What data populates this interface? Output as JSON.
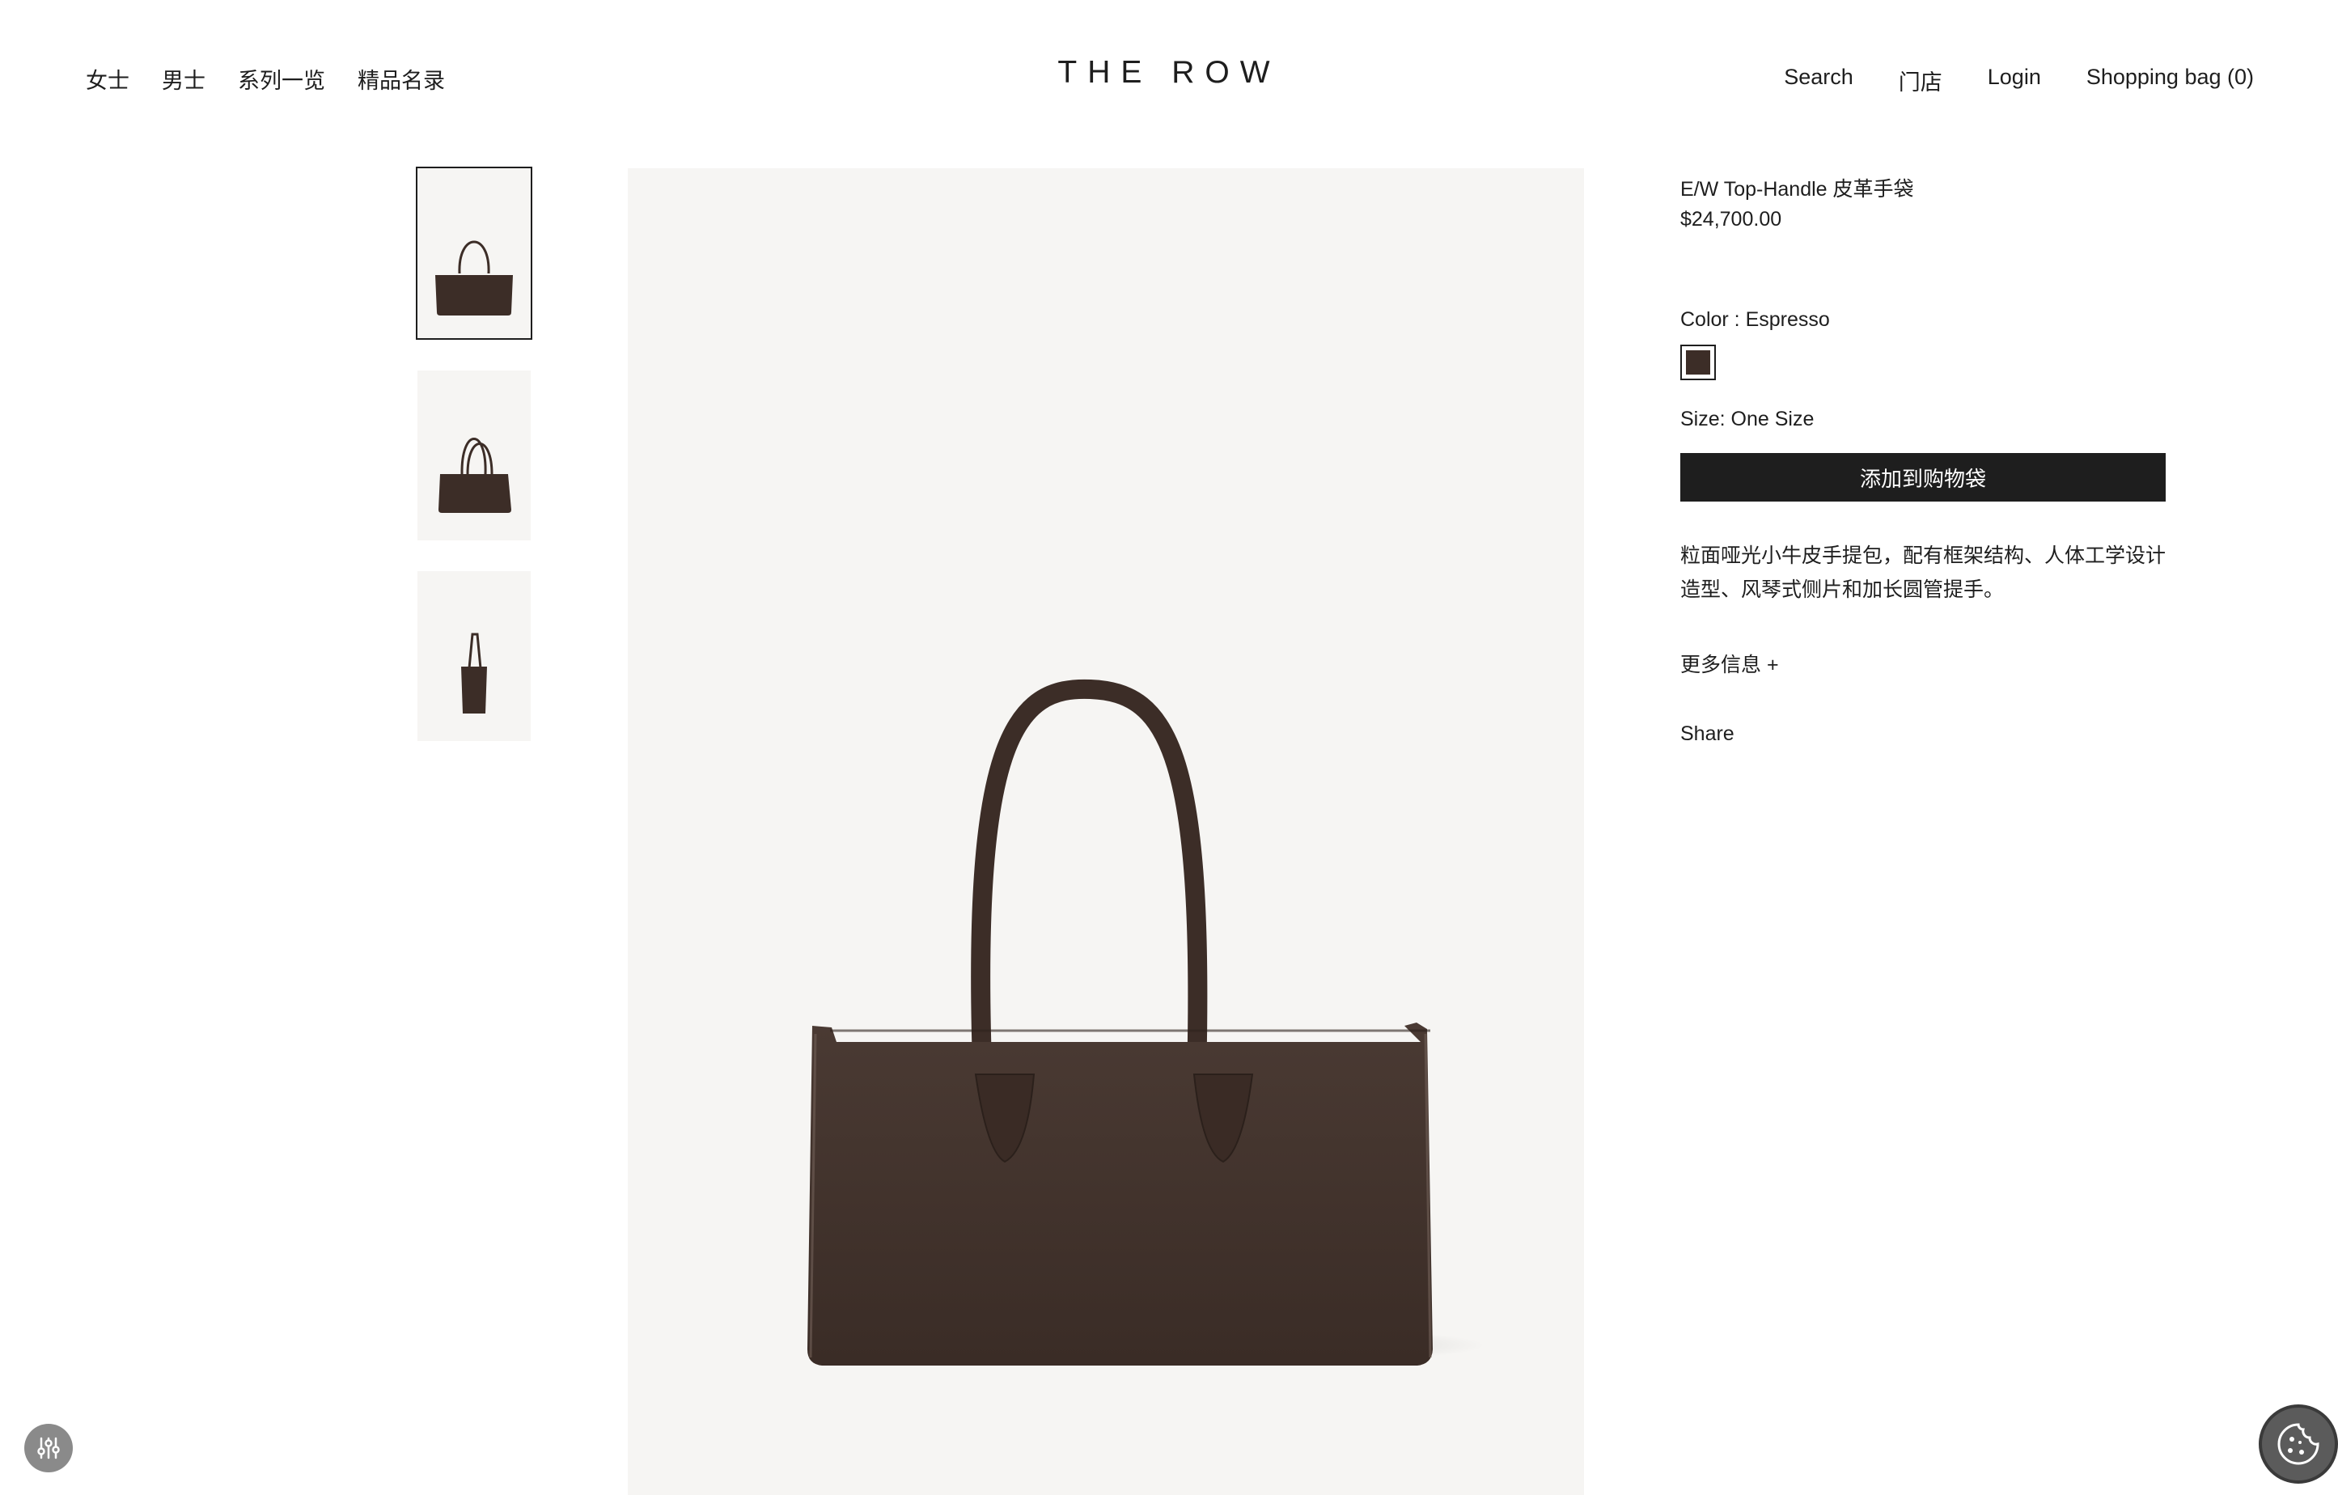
{
  "header": {
    "brand": "THE ROW",
    "nav_left": [
      "女士",
      "男士",
      "系列一览",
      "精品名录"
    ],
    "nav_right": {
      "search": "Search",
      "stores": "门店",
      "login": "Login",
      "bag": "Shopping bag (0)"
    }
  },
  "gallery": {
    "thumbnails": [
      "front-view",
      "angled-view",
      "side-view"
    ],
    "selected_index": 0
  },
  "product": {
    "title": "E/W Top-Handle 皮革手袋",
    "price": "$24,700.00",
    "color_label": "Color : Espresso",
    "swatch_color": "#3c2d27",
    "size_label": "Size: One Size",
    "add_to_bag": "添加到购物袋",
    "description": "粒面哑光小牛皮手提包，配有框架结构、人体工学设计造型、风琴式侧片和加长圆管提手。",
    "more_info": "更多信息 +",
    "share": "Share"
  },
  "colors": {
    "text": "#1e1e1e",
    "image_bg": "#f6f5f3",
    "leather": "#3c2d27",
    "button_bg": "#1e1e1e"
  },
  "widgets": {
    "settings_icon": "sliders-icon",
    "cookie_icon": "cookie-icon"
  }
}
